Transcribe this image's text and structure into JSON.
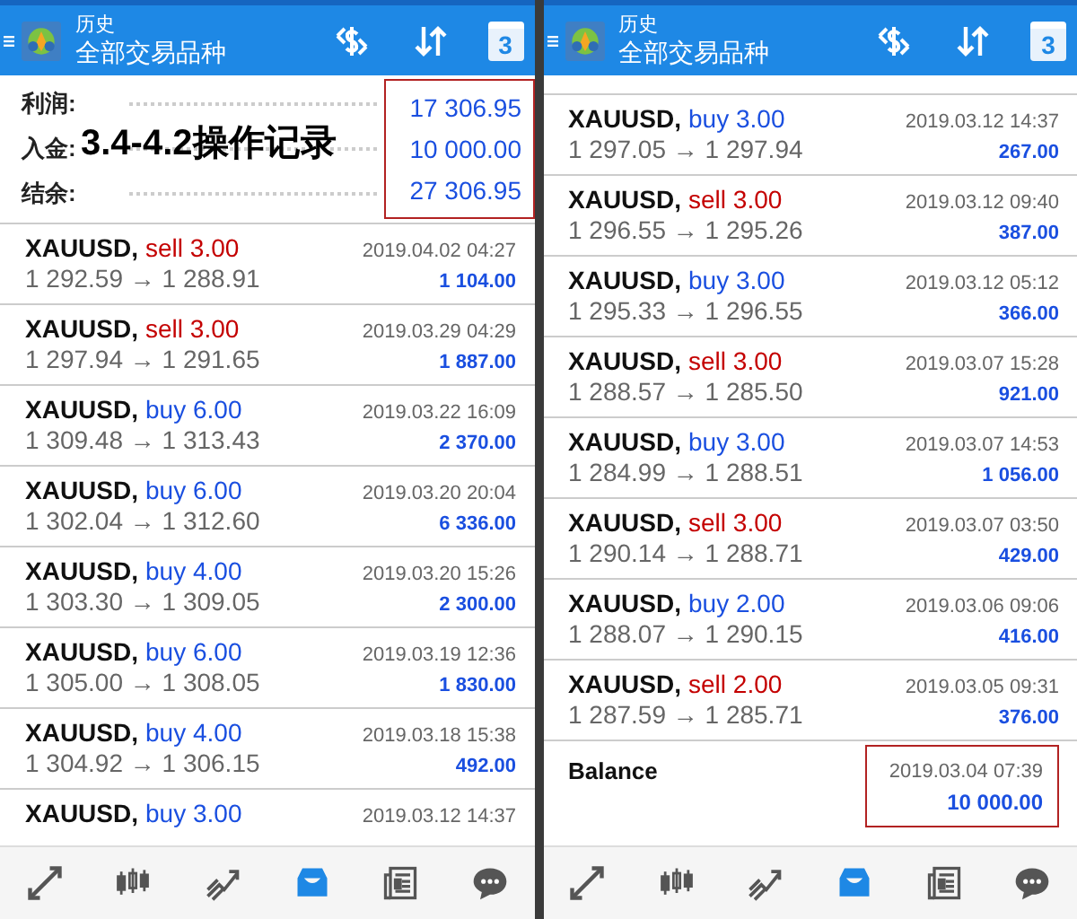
{
  "panels": [
    {
      "header": {
        "title": "历史",
        "subtitle": "全部交易品种",
        "calendar_day": "3"
      },
      "summary": {
        "highlighted": true,
        "rows": [
          {
            "label": "利润:",
            "value": "17 306.95"
          },
          {
            "label": "入金:",
            "value": "10 000.00"
          },
          {
            "label": "结余:",
            "value": "27 306.95"
          }
        ]
      },
      "annotation": "3.4-4.2操作记录",
      "trades": [
        {
          "symbol": "XAUUSD,",
          "kind": "sell",
          "order": "sell 3.00",
          "time": "2019.04.02 04:27",
          "prices": "1 292.59 → 1 288.91",
          "profit": "1 104.00"
        },
        {
          "symbol": "XAUUSD,",
          "kind": "sell",
          "order": "sell 3.00",
          "time": "2019.03.29 04:29",
          "prices": "1 297.94 → 1 291.65",
          "profit": "1 887.00"
        },
        {
          "symbol": "XAUUSD,",
          "kind": "buy",
          "order": "buy 6.00",
          "time": "2019.03.22 16:09",
          "prices": "1 309.48 → 1 313.43",
          "profit": "2 370.00"
        },
        {
          "symbol": "XAUUSD,",
          "kind": "buy",
          "order": "buy 6.00",
          "time": "2019.03.20 20:04",
          "prices": "1 302.04 → 1 312.60",
          "profit": "6 336.00"
        },
        {
          "symbol": "XAUUSD,",
          "kind": "buy",
          "order": "buy 4.00",
          "time": "2019.03.20 15:26",
          "prices": "1 303.30 → 1 309.05",
          "profit": "2 300.00"
        },
        {
          "symbol": "XAUUSD,",
          "kind": "buy",
          "order": "buy 6.00",
          "time": "2019.03.19 12:36",
          "prices": "1 305.00 → 1 308.05",
          "profit": "1 830.00"
        },
        {
          "symbol": "XAUUSD,",
          "kind": "buy",
          "order": "buy 4.00",
          "time": "2019.03.18 15:38",
          "prices": "1 304.92 → 1 306.15",
          "profit": "492.00"
        },
        {
          "symbol": "XAUUSD,",
          "kind": "buy",
          "order": "buy 3.00",
          "time": "2019.03.12 14:37"
        }
      ],
      "nav": [
        {
          "kind": "trade",
          "selected": false
        },
        {
          "kind": "chart",
          "selected": false
        },
        {
          "kind": "trend",
          "selected": false
        },
        {
          "kind": "history",
          "selected": true
        },
        {
          "kind": "news",
          "selected": false
        },
        {
          "kind": "chat",
          "selected": false
        }
      ]
    },
    {
      "header": {
        "title": "历史",
        "subtitle": "全部交易品种",
        "calendar_day": "3"
      },
      "trades": [
        {
          "symbol": "XAUUSD,",
          "kind": "buy",
          "order": "buy 3.00",
          "time": "2019.03.12 14:37",
          "prices": "1 297.05 → 1 297.94",
          "profit": "267.00"
        },
        {
          "symbol": "XAUUSD,",
          "kind": "sell",
          "order": "sell 3.00",
          "time": "2019.03.12 09:40",
          "prices": "1 296.55 → 1 295.26",
          "profit": "387.00"
        },
        {
          "symbol": "XAUUSD,",
          "kind": "buy",
          "order": "buy 3.00",
          "time": "2019.03.12 05:12",
          "prices": "1 295.33 → 1 296.55",
          "profit": "366.00"
        },
        {
          "symbol": "XAUUSD,",
          "kind": "sell",
          "order": "sell 3.00",
          "time": "2019.03.07 15:28",
          "prices": "1 288.57 → 1 285.50",
          "profit": "921.00"
        },
        {
          "symbol": "XAUUSD,",
          "kind": "buy",
          "order": "buy 3.00",
          "time": "2019.03.07 14:53",
          "prices": "1 284.99 → 1 288.51",
          "profit": "1 056.00"
        },
        {
          "symbol": "XAUUSD,",
          "kind": "sell",
          "order": "sell 3.00",
          "time": "2019.03.07 03:50",
          "prices": "1 290.14 → 1 288.71",
          "profit": "429.00"
        },
        {
          "symbol": "XAUUSD,",
          "kind": "buy",
          "order": "buy 2.00",
          "time": "2019.03.06 09:06",
          "prices": "1 288.07 → 1 290.15",
          "profit": "416.00"
        },
        {
          "symbol": "XAUUSD,",
          "kind": "sell",
          "order": "sell 2.00",
          "time": "2019.03.05 09:31",
          "prices": "1 287.59 → 1 285.71",
          "profit": "376.00"
        }
      ],
      "balance": {
        "label": "Balance",
        "time": "2019.03.04 07:39",
        "amount": "10 000.00",
        "highlighted": true
      },
      "nav": [
        {
          "kind": "trade",
          "selected": false
        },
        {
          "kind": "chart",
          "selected": false
        },
        {
          "kind": "trend",
          "selected": false
        },
        {
          "kind": "history",
          "selected": true
        },
        {
          "kind": "news",
          "selected": false
        },
        {
          "kind": "chat",
          "selected": false
        }
      ]
    }
  ]
}
